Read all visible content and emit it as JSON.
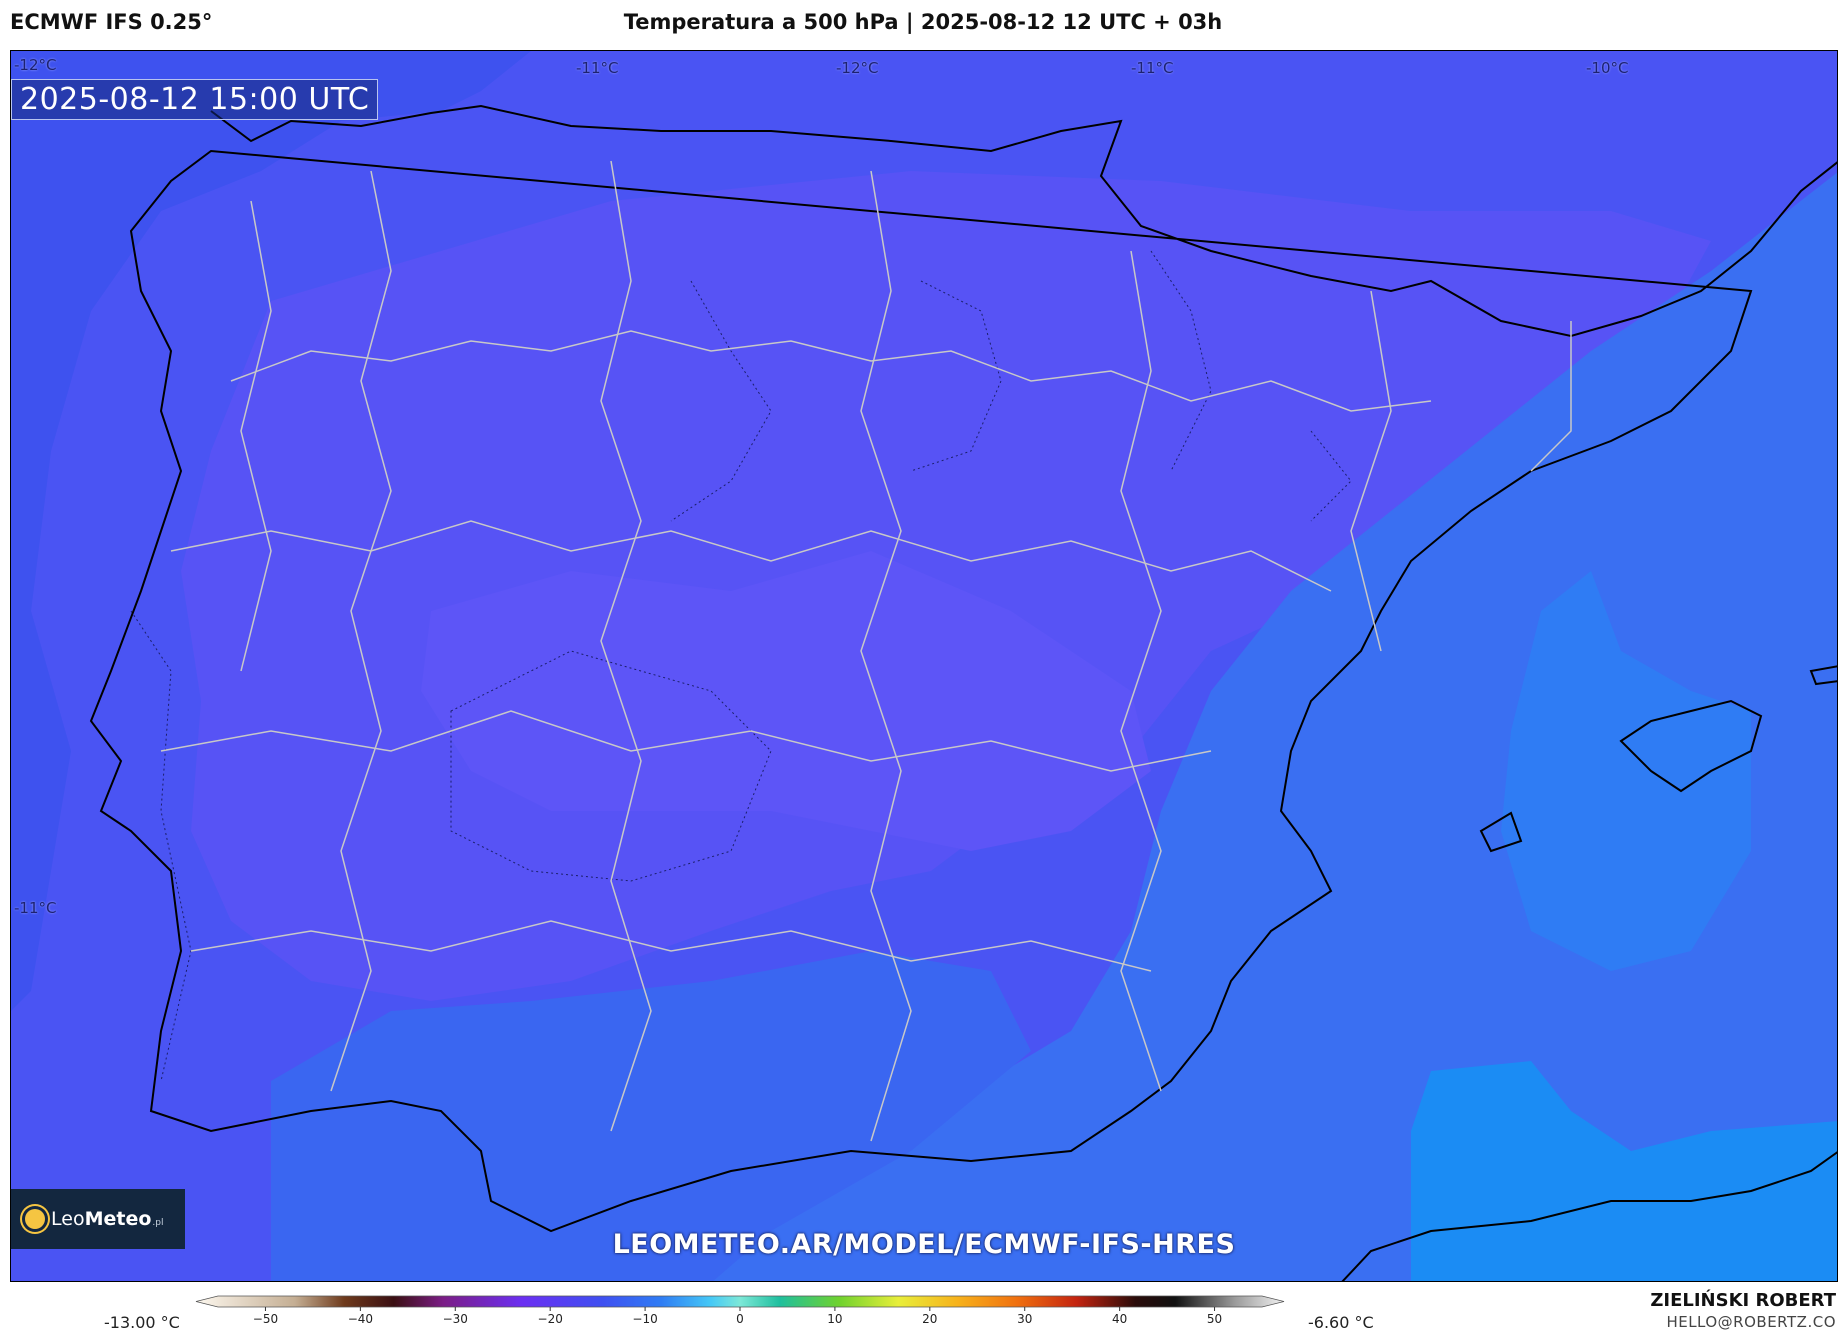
{
  "header": {
    "model": "ECMWF IFS 0.25°",
    "title": "Temperatura a 500 hPa | 2025-08-12 12 UTC + 03h"
  },
  "map": {
    "valid_time": "2025-08-12 15:00 UTC",
    "region": "Iberian Peninsula",
    "isotherm_labels": [
      "-12°C",
      "-11°C",
      "-12°C",
      "-11°C",
      "-10°C",
      "-11°C"
    ],
    "colors": {
      "coldest_fill": "#3e52ef",
      "mid_fill": "#5753f5",
      "violet_fill": "#5d55f7",
      "sea_fill": "#3a6ff2",
      "warm_sea_fill": "#1b8cf4",
      "coast": "#000000",
      "borders": "#c8c8c8"
    },
    "logo": {
      "brand_light": "Leo",
      "brand_bold": "Meteo",
      "suffix": ".pl"
    },
    "watermark": "LEOMETEO.AR/MODEL/ECMWF-IFS-HRES"
  },
  "colorbar": {
    "min_label": "-13.00 °C",
    "max_label": "-6.60 °C",
    "range": [
      -55,
      55
    ],
    "ticks": [
      "−50",
      "−40",
      "−30",
      "−20",
      "−10",
      "0",
      "10",
      "20",
      "30",
      "40",
      "50"
    ],
    "stops": [
      {
        "v": -55,
        "c": "#fdf8ef"
      },
      {
        "v": -45,
        "c": "#c4ae93"
      },
      {
        "v": -40,
        "c": "#6e3a1c"
      },
      {
        "v": -35,
        "c": "#3a0f12"
      },
      {
        "v": -30,
        "c": "#7b1d86"
      },
      {
        "v": -22,
        "c": "#6b2ff2"
      },
      {
        "v": -14,
        "c": "#3f4ff1"
      },
      {
        "v": -8,
        "c": "#2f7cf4"
      },
      {
        "v": -3,
        "c": "#45c8f6"
      },
      {
        "v": 0,
        "c": "#7de8d8"
      },
      {
        "v": 4,
        "c": "#1fbf9e"
      },
      {
        "v": 10,
        "c": "#6fd22e"
      },
      {
        "v": 16,
        "c": "#e8ee3a"
      },
      {
        "v": 22,
        "c": "#f7b21b"
      },
      {
        "v": 28,
        "c": "#f0700f"
      },
      {
        "v": 34,
        "c": "#c42410"
      },
      {
        "v": 40,
        "c": "#2a0c0a"
      },
      {
        "v": 44,
        "c": "#111111"
      },
      {
        "v": 50,
        "c": "#9a9a9a"
      },
      {
        "v": 55,
        "c": "#f2f2f2"
      }
    ]
  },
  "author": {
    "name": "ZIELIŃSKI ROBERT",
    "email": "HELLO@ROBERTZ.CO"
  }
}
